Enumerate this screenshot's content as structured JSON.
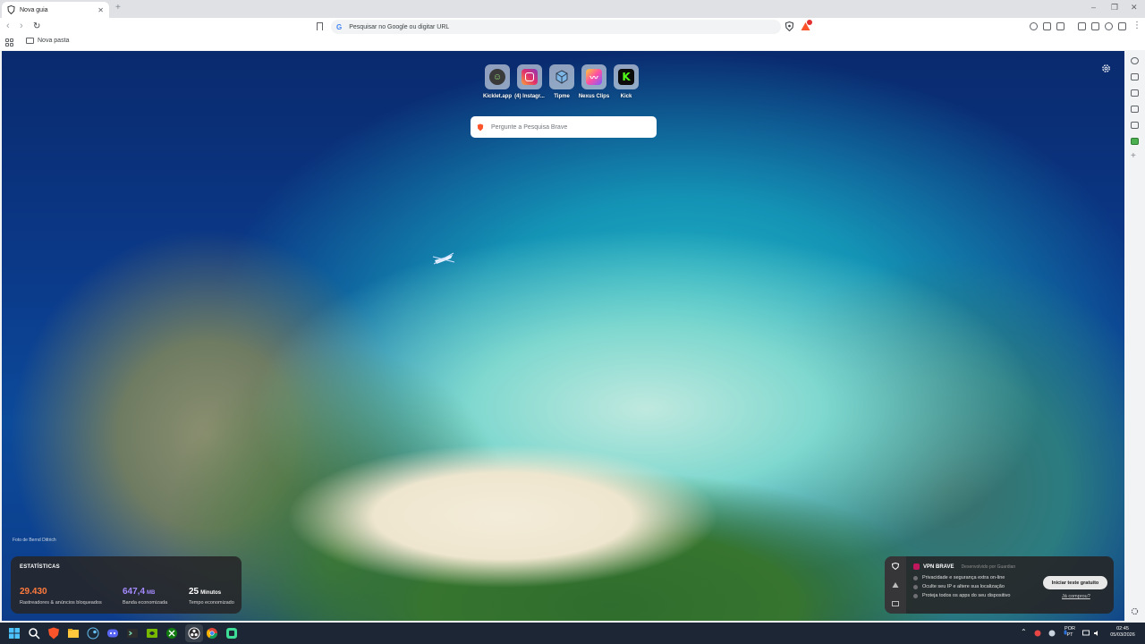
{
  "browser": {
    "tab_title": "Nova guia",
    "new_tab_symbol": "+",
    "window_controls": [
      "–",
      "❐",
      "✕"
    ],
    "address_placeholder": "Pesquisar no Google ou digitar URL",
    "bookmark_folder": "Nova pasta",
    "menu_symbol": "⋮"
  },
  "shortcuts": [
    {
      "label": "Kicklet.app",
      "icon": "kicklet-icon"
    },
    {
      "label": "(4) Instagr...",
      "icon": "instagram-icon"
    },
    {
      "label": "Tipme",
      "icon": "tipme-icon"
    },
    {
      "label": "Nexus Clips",
      "icon": "nexus-clips-icon"
    },
    {
      "label": "Kick",
      "icon": "kick-icon"
    }
  ],
  "search": {
    "placeholder": "Pergunte a Pesquisa Brave"
  },
  "photo_credit": "Foto de Bernd Dittrich",
  "stats": {
    "header": "ESTATÍSTICAS",
    "trackers": {
      "value": "29.430",
      "caption": "Rastreadores & anúncios bloqueados",
      "color": "#ff7a3d"
    },
    "bandwidth": {
      "value": "647,4",
      "unit": "MB",
      "caption": "Banda economizada",
      "color": "#a58bff"
    },
    "time": {
      "value": "25",
      "unit": "Minutos",
      "caption": "Tempo economizado",
      "color": "#ffffff"
    }
  },
  "vpn": {
    "title": "VPN BRAVE",
    "provider": "Desenvolvido por Guardian",
    "features": [
      "Privacidade e segurança extra on-line",
      "Oculte seu IP e altere sua localização",
      "Proteja todos os apps do seu dispositivo"
    ],
    "cta": "Iniciar teste gratuito",
    "link": "Já comprou?"
  },
  "taskbar": {
    "language": "POR",
    "region": "PT",
    "time": "02:45",
    "date": "05/03/2026"
  },
  "colors": {
    "brave_orange": "#fb542b",
    "vpn_accent": "#c0175d"
  }
}
